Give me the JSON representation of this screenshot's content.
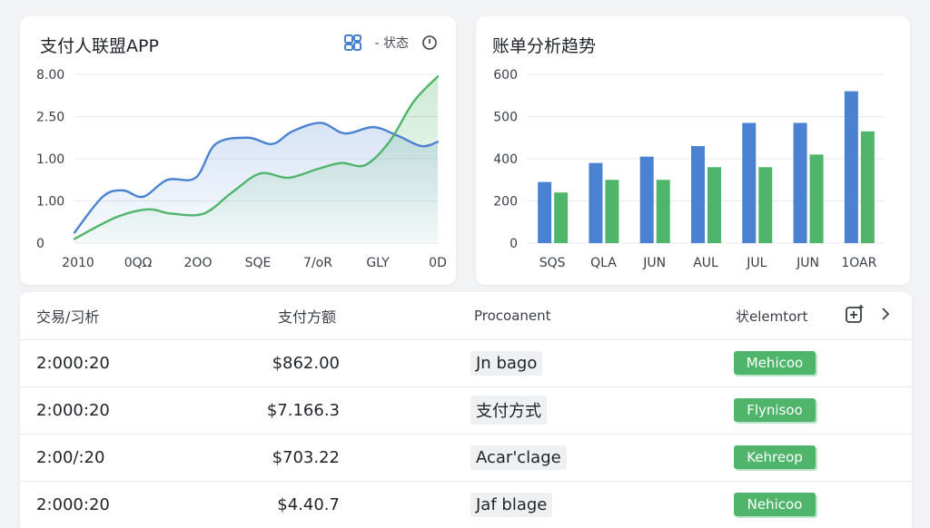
{
  "left_panel": {
    "title": "支付人联盟APP",
    "status_label": "- 状态",
    "icons": [
      "grid-chart-icon",
      "info-icon"
    ]
  },
  "right_panel": {
    "title": "账单分析趋势"
  },
  "colors": {
    "blue": "#4a82d1",
    "green": "#4fb56a",
    "status_green": "#4fb56a"
  },
  "chart_data": [
    {
      "type": "area",
      "title": "",
      "yticks": [
        "8.00",
        "2.50",
        "1.00",
        "1.00",
        "0"
      ],
      "xticks": [
        "2010",
        "0QΩ",
        "2OO",
        "SQE",
        "7/oR",
        "GLY",
        "0D"
      ],
      "ylim": [
        0,
        4
      ],
      "grid": true,
      "series": [
        {
          "color": "#4a82d1",
          "x": [
            0,
            0.35,
            0.6,
            0.85,
            1.15,
            1.5,
            1.75,
            2.15,
            2.45,
            2.7,
            3.05,
            3.35,
            3.7,
            4.0,
            4.3,
            4.5
          ],
          "values": [
            0.25,
            1.1,
            1.25,
            1.1,
            1.5,
            1.55,
            2.35,
            2.5,
            2.35,
            2.65,
            2.85,
            2.6,
            2.75,
            2.55,
            2.3,
            2.4
          ]
        },
        {
          "color": "#4fb56a",
          "x": [
            0,
            0.5,
            0.9,
            1.2,
            1.6,
            1.95,
            2.3,
            2.65,
            3.0,
            3.3,
            3.6,
            3.9,
            4.2,
            4.5
          ],
          "values": [
            0.1,
            0.6,
            0.8,
            0.7,
            0.7,
            1.2,
            1.65,
            1.55,
            1.75,
            1.9,
            1.85,
            2.4,
            3.35,
            3.95
          ]
        }
      ]
    },
    {
      "type": "bar",
      "title": "",
      "yticks": [
        "600",
        "500",
        "400",
        "200",
        "0"
      ],
      "categories": [
        "SQS",
        "QLA",
        "JUN",
        "AUL",
        "JUL",
        "JUN",
        "1OAR"
      ],
      "ylim": [
        0,
        4
      ],
      "grid": true,
      "series": [
        {
          "color": "#4a82d1",
          "values": [
            1.45,
            1.9,
            2.05,
            2.3,
            2.85,
            2.85,
            3.6
          ]
        },
        {
          "color": "#4fb56a",
          "values": [
            1.2,
            1.5,
            1.5,
            1.8,
            1.8,
            2.1,
            2.65
          ]
        }
      ]
    }
  ],
  "table": {
    "headers": {
      "time": "交易/习析",
      "amount": "支付方额",
      "method": "Procoanent",
      "status": "状elemtort"
    },
    "head_icons": [
      "add-widget-icon",
      "chevron-right-icon"
    ],
    "rows": [
      {
        "time": "2:000:20",
        "amount": "$862.00",
        "method": "Jn bago",
        "status": "Mehicoo"
      },
      {
        "time": "2:000:20",
        "amount": "$7.166.3",
        "method": "支付方式",
        "status": "Flynisoo"
      },
      {
        "time": "2:00/:20",
        "amount": "$703.22",
        "method": "Acar'clage",
        "status": "Kehreop"
      },
      {
        "time": "2:000:20",
        "amount": "$4.40.7",
        "method": "Jaf blage",
        "status": "Nehicoo"
      }
    ]
  }
}
